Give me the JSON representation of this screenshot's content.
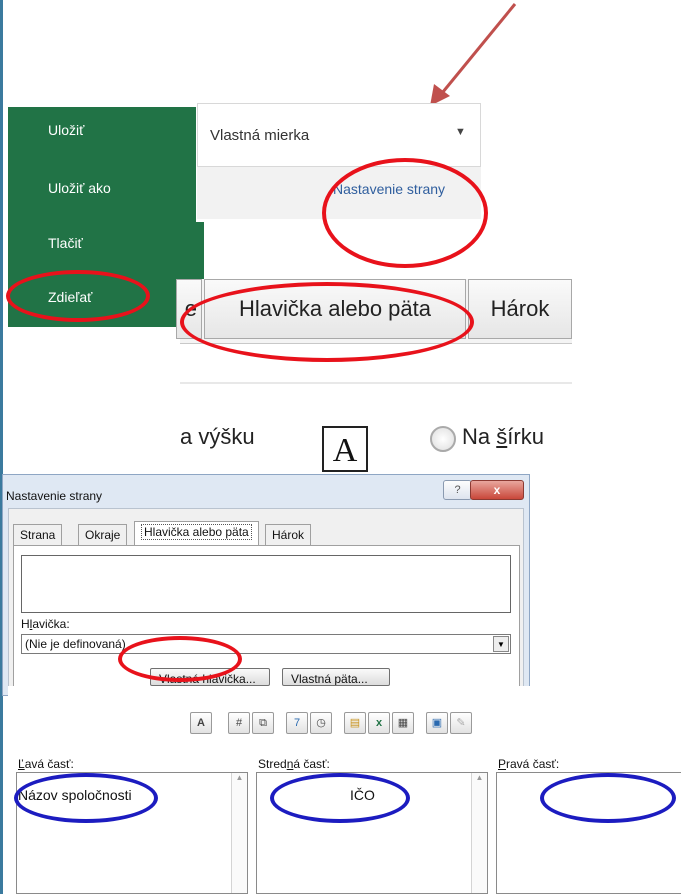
{
  "file_menu": {
    "items": [
      "Uložiť",
      "Uložiť ako",
      "Tlačiť",
      "Zdieľať"
    ]
  },
  "print_settings": {
    "scaling_value": "Vlastná mierka",
    "page_setup_link": "Nastavenie strany"
  },
  "enlarged_tabs": {
    "left_fragment": "e",
    "header_footer": "Hlavička alebo päta",
    "sheet": "Hárok"
  },
  "orientation": {
    "portrait_fragment": "a výšku",
    "landscape_prefix": "Na ",
    "landscape_underlined": "š",
    "landscape_suffix": "írku",
    "page_icon_letter": "A"
  },
  "page_setup_dialog": {
    "title": "Nastavenie strany",
    "help": "?",
    "close": "x",
    "tabs": [
      "Strana",
      "Okraje",
      "Hlavička alebo päta",
      "Hárok"
    ],
    "header_label_prefix": "H",
    "header_label_underlined": "l",
    "header_label_suffix": "avička:",
    "header_value": "(Nie je definovaná)",
    "custom_header_button": "Vlastná hlavička...",
    "custom_footer_button": "Vlastná päta..."
  },
  "custom_header": {
    "toolbar": [
      "format-text",
      "page-number",
      "number-of-pages",
      "date",
      "time",
      "file-path",
      "file-name",
      "sheet-name",
      "insert-picture",
      "format-picture"
    ],
    "sections": [
      {
        "label_u": "Ľ",
        "label_rest": "avá časť:",
        "value": "Názov spoločnosti"
      },
      {
        "label_pre": "Stred",
        "label_u": "n",
        "label_rest": "á časť:",
        "value": "IČO"
      },
      {
        "label_u": "P",
        "label_rest": "ravá časť:",
        "value": ""
      }
    ]
  },
  "colors": {
    "annotation_red": "#e8121b",
    "annotation_blue": "#1c1cc0",
    "excel_green": "#217346"
  }
}
